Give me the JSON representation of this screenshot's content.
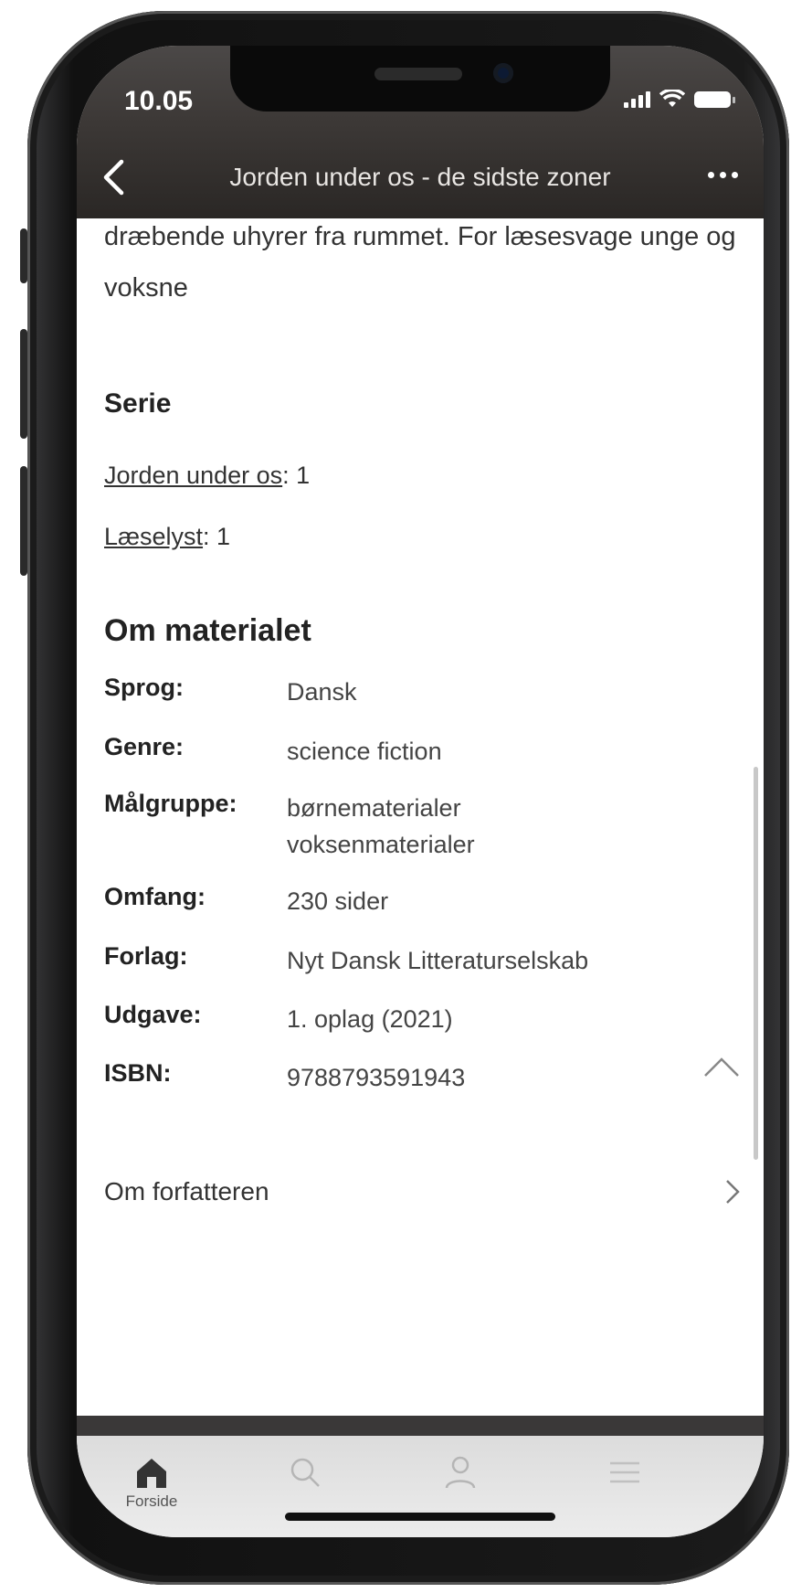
{
  "status_bar": {
    "time": "10.05"
  },
  "nav": {
    "title": "Jorden under os - de sidste zoner"
  },
  "description": "dræbende uhyrer fra rummet. For læsesvage unge og voksne",
  "series_section": {
    "title": "Serie",
    "items": [
      {
        "link": "Jorden under os",
        "suffix": ": 1"
      },
      {
        "link": "Læselyst",
        "suffix": ": 1"
      }
    ]
  },
  "material_section": {
    "title": "Om materialet",
    "rows": [
      {
        "label": "Sprog:",
        "value": "Dansk"
      },
      {
        "label": "Genre:",
        "value": "science fiction"
      },
      {
        "label": "Målgruppe:",
        "value": "børnematerialer",
        "value2": "voksenmaterialer"
      },
      {
        "label": "Omfang:",
        "value": "230 sider"
      },
      {
        "label": "Forlag:",
        "value": "Nyt Dansk Litteraturselskab"
      },
      {
        "label": "Udgave:",
        "value": "1. oplag (2021)"
      },
      {
        "label": "ISBN:",
        "value": "9788793591943"
      }
    ]
  },
  "about_author": {
    "label": "Om forfatteren"
  },
  "tabbar": {
    "items": [
      {
        "label": "Forside",
        "icon": "home-icon",
        "active": true
      },
      {
        "label": "",
        "icon": "search-icon"
      },
      {
        "label": "",
        "icon": "profile-icon"
      },
      {
        "label": "",
        "icon": "menu-icon"
      }
    ]
  },
  "colors": {
    "header": "#3c3836",
    "tab_active": "#333333"
  }
}
